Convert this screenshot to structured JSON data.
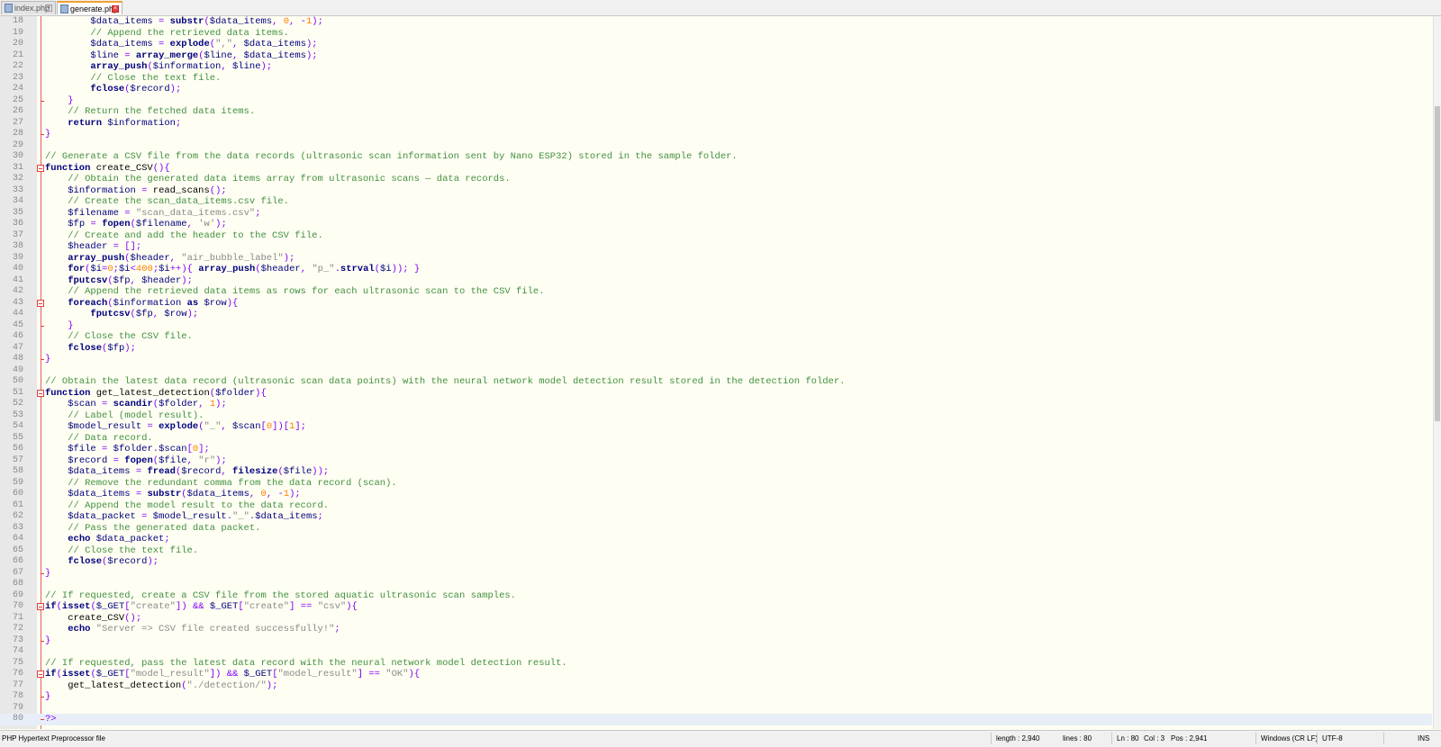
{
  "tabs": [
    {
      "label": "index.php",
      "active": false
    },
    {
      "label": "generate.php",
      "active": true
    }
  ],
  "editor": {
    "current_line": 80,
    "lines": [
      {
        "n": "18",
        "code": "        $data_items = substr($data_items, 0, -1);"
      },
      {
        "n": "19",
        "code": "        // Append the retrieved data items."
      },
      {
        "n": "20",
        "code": "        $data_items = explode(\",\", $data_items);"
      },
      {
        "n": "21",
        "code": "        $line = array_merge($line, $data_items);"
      },
      {
        "n": "22",
        "code": "        array_push($information, $line);"
      },
      {
        "n": "23",
        "code": "        // Close the text file."
      },
      {
        "n": "24",
        "code": "        fclose($record);"
      },
      {
        "n": "25",
        "code": "    }"
      },
      {
        "n": "26",
        "code": "    // Return the fetched data items."
      },
      {
        "n": "27",
        "code": "    return $information;"
      },
      {
        "n": "28",
        "code": "}"
      },
      {
        "n": "29",
        "code": ""
      },
      {
        "n": "30",
        "code": "// Generate a CSV file from the data records (ultrasonic scan information sent by Nano ESP32) stored in the sample folder."
      },
      {
        "n": "31",
        "code": "function create_CSV(){"
      },
      {
        "n": "32",
        "code": "    // Obtain the generated data items array from ultrasonic scans — data records."
      },
      {
        "n": "33",
        "code": "    $information = read_scans();"
      },
      {
        "n": "34",
        "code": "    // Create the scan_data_items.csv file."
      },
      {
        "n": "35",
        "code": "    $filename = \"scan_data_items.csv\";"
      },
      {
        "n": "36",
        "code": "    $fp = fopen($filename, 'w');"
      },
      {
        "n": "37",
        "code": "    // Create and add the header to the CSV file."
      },
      {
        "n": "38",
        "code": "    $header = [];"
      },
      {
        "n": "39",
        "code": "    array_push($header, \"air_bubble_label\");"
      },
      {
        "n": "40",
        "code": "    for($i=0;$i<400;$i++){ array_push($header, \"p_\".strval($i)); }"
      },
      {
        "n": "41",
        "code": "    fputcsv($fp, $header);"
      },
      {
        "n": "42",
        "code": "    // Append the retrieved data items as rows for each ultrasonic scan to the CSV file."
      },
      {
        "n": "43",
        "code": "    foreach($information as $row){"
      },
      {
        "n": "44",
        "code": "        fputcsv($fp, $row);"
      },
      {
        "n": "45",
        "code": "    }"
      },
      {
        "n": "46",
        "code": "    // Close the CSV file."
      },
      {
        "n": "47",
        "code": "    fclose($fp);"
      },
      {
        "n": "48",
        "code": "}"
      },
      {
        "n": "49",
        "code": ""
      },
      {
        "n": "50",
        "code": "// Obtain the latest data record (ultrasonic scan data points) with the neural network model detection result stored in the detection folder."
      },
      {
        "n": "51",
        "code": "function get_latest_detection($folder){"
      },
      {
        "n": "52",
        "code": "    $scan = scandir($folder, 1);"
      },
      {
        "n": "53",
        "code": "    // Label (model result)."
      },
      {
        "n": "54",
        "code": "    $model_result = explode(\"_\", $scan[0])[1];"
      },
      {
        "n": "55",
        "code": "    // Data record."
      },
      {
        "n": "56",
        "code": "    $file = $folder.$scan[0];"
      },
      {
        "n": "57",
        "code": "    $record = fopen($file, \"r\");"
      },
      {
        "n": "58",
        "code": "    $data_items = fread($record, filesize($file));"
      },
      {
        "n": "59",
        "code": "    // Remove the redundant comma from the data record (scan)."
      },
      {
        "n": "60",
        "code": "    $data_items = substr($data_items, 0, -1);"
      },
      {
        "n": "61",
        "code": "    // Append the model result to the data record."
      },
      {
        "n": "62",
        "code": "    $data_packet = $model_result.\"_\".$data_items;"
      },
      {
        "n": "63",
        "code": "    // Pass the generated data packet."
      },
      {
        "n": "64",
        "code": "    echo $data_packet;"
      },
      {
        "n": "65",
        "code": "    // Close the text file."
      },
      {
        "n": "66",
        "code": "    fclose($record);"
      },
      {
        "n": "67",
        "code": "}"
      },
      {
        "n": "68",
        "code": ""
      },
      {
        "n": "69",
        "code": "// If requested, create a CSV file from the stored aquatic ultrasonic scan samples."
      },
      {
        "n": "70",
        "code": "if(isset($_GET[\"create\"]) && $_GET[\"create\"] == \"csv\"){"
      },
      {
        "n": "71",
        "code": "    create_CSV();"
      },
      {
        "n": "72",
        "code": "    echo \"Server => CSV file created successfully!\";"
      },
      {
        "n": "73",
        "code": "}"
      },
      {
        "n": "74",
        "code": ""
      },
      {
        "n": "75",
        "code": "// If requested, pass the latest data record with the neural network model detection result."
      },
      {
        "n": "76",
        "code": "if(isset($_GET[\"model_result\"]) && $_GET[\"model_result\"] == \"OK\"){"
      },
      {
        "n": "77",
        "code": "    get_latest_detection(\"./detection/\");"
      },
      {
        "n": "78",
        "code": "}"
      },
      {
        "n": "79",
        "code": ""
      },
      {
        "n": "80",
        "code": "?>"
      }
    ]
  },
  "status": {
    "file_type": "PHP Hypertext Preprocessor file",
    "length": "length : 2,940",
    "lines": "lines : 80",
    "ln": "Ln : 80",
    "col": "Col : 3",
    "pos": "Pos : 2,941",
    "eol": "Windows (CR LF)",
    "encoding": "UTF-8",
    "mode": "INS"
  }
}
